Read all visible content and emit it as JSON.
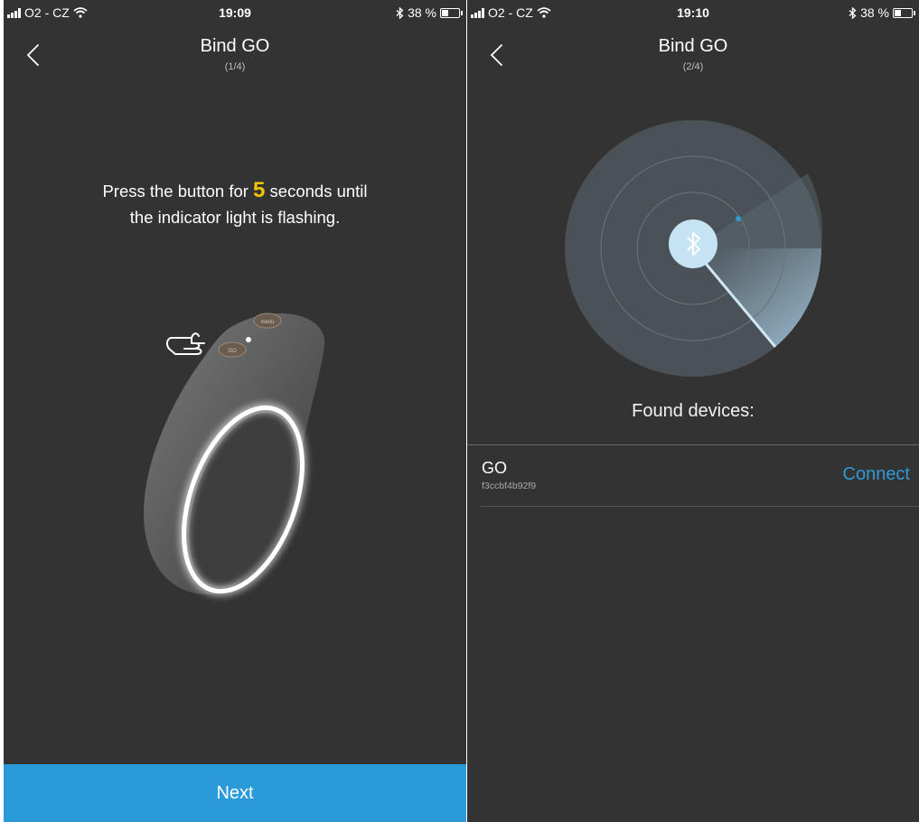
{
  "left_screen": {
    "status": {
      "carrier": "O2 - CZ",
      "time": "19:09",
      "battery": "38 %",
      "battery_level": 0.38
    },
    "nav": {
      "title": "Bind GO",
      "step": "(1/4)"
    },
    "instruction": {
      "part1": "Press the button for ",
      "highlight": "5",
      "part2": " seconds until",
      "line2": "the indicator light is flashing."
    },
    "device_labels": {
      "top_button": "menu",
      "bottom_button": "GO"
    },
    "next_button": "Next"
  },
  "right_screen": {
    "status": {
      "carrier": "O2 - CZ",
      "time": "19:10",
      "battery": "38 %",
      "battery_level": 0.38
    },
    "nav": {
      "title": "Bind GO",
      "step": "(2/4)"
    },
    "found_label": "Found devices:",
    "devices": [
      {
        "name": "GO",
        "id": "f3ccbf4b92f9",
        "action": "Connect"
      }
    ]
  },
  "colors": {
    "background": "#333333",
    "accent": "#2a9bd8",
    "link": "#2f9ad6",
    "highlight": "#f5c400"
  }
}
